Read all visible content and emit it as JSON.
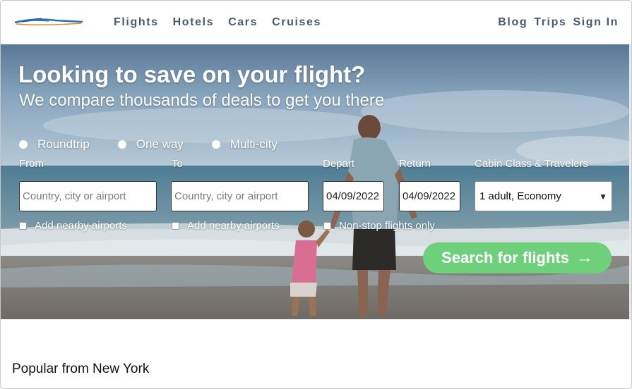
{
  "header": {
    "logo_alt": "",
    "nav_left": [
      "Flights",
      "Hotels",
      "Cars",
      "Cruises"
    ],
    "nav_right": [
      "Blog",
      "Trips",
      "Sign In"
    ]
  },
  "hero": {
    "headline": "Looking to save on your flight?",
    "subhead": "We compare thousands of deals to get you there",
    "trip_types": [
      "Roundtrip",
      "One way",
      "Multi-city"
    ],
    "labels": {
      "from": "From",
      "to": "To",
      "depart": "Depart",
      "return": "Return",
      "cabin": "Cabin Class & Travelers"
    },
    "inputs": {
      "from_placeholder": "Country, city or airport",
      "to_placeholder": "Country, city or airport",
      "depart_value": "04/09/2022",
      "return_value": "04/09/2022",
      "cabin_value": "1 adult, Economy"
    },
    "checks": {
      "from_nearby": "Add nearby airports",
      "to_nearby": "Add nearby airports",
      "nonstop": "Non-stop flights only"
    },
    "search_label": "Search for flights",
    "search_icon": "arrow-right-icon"
  },
  "popular": {
    "title": "Popular from New York"
  },
  "colors": {
    "nav_text": "#4a5a6e",
    "search_button": "#6ed07a",
    "hero_text": "#ffffff"
  }
}
